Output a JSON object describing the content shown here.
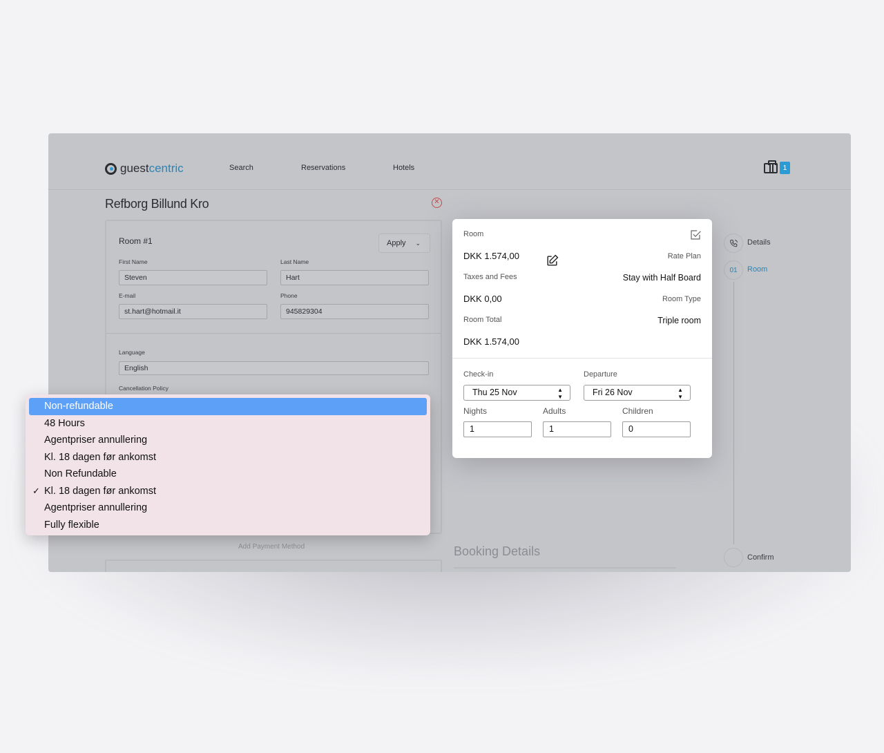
{
  "navbar": {
    "logo_part1": "guest",
    "logo_part2": "centric",
    "links": [
      "Search",
      "Reservations",
      "Hotels"
    ],
    "cart_count": "1"
  },
  "hotel": {
    "title": "Refborg Billund Kro"
  },
  "form": {
    "room_label": "Room #1",
    "apply_label": "Apply",
    "first_name_label": "First Name",
    "first_name_value": "Steven",
    "last_name_label": "Last Name",
    "last_name_value": "Hart",
    "email_label": "E-mail",
    "email_value": "st.hart@hotmail.it",
    "phone_label": "Phone",
    "phone_value": "945829304",
    "language_label": "Language",
    "language_value": "English",
    "cancellation_label": "Cancellation Policy",
    "payment_hint": "Add Payment Method"
  },
  "booking_details_title": "Booking Details",
  "steps": {
    "details_label": "Details",
    "room_number": "01",
    "room_label": "Room",
    "confirm_label": "Confirm"
  },
  "room_card": {
    "room_label": "Room",
    "room_price": "DKK 1.574,00",
    "rate_plan_label": "Rate Plan",
    "rate_plan_value": "Stay with Half Board",
    "taxes_label": "Taxes and Fees",
    "taxes_value": "DKK 0,00",
    "room_type_label": "Room Type",
    "room_type_value": "Triple room",
    "room_total_label": "Room Total",
    "room_total_value": "DKK 1.574,00",
    "checkin_label": "Check-in",
    "checkin_value": "Thu 25 Nov",
    "departure_label": "Departure",
    "departure_value": "Fri 26 Nov",
    "nights_label": "Nights",
    "nights_value": "1",
    "adults_label": "Adults",
    "adults_value": "1",
    "children_label": "Children",
    "children_value": "0"
  },
  "cancellation_dropdown": {
    "options": [
      "Non-refundable",
      "48 Hours",
      "Agentpriser annullering",
      "Kl. 18 dagen før ankomst",
      "Non Refundable",
      "Kl. 18 dagen før ankomst",
      "Agentpriser annullering",
      "Fully flexible"
    ],
    "highlighted_index": 0,
    "checked_index": 5,
    "check_mark": "✓"
  },
  "colors": {
    "accent": "#2b84b5",
    "highlight": "#5ca1f7",
    "dropdown_bg": "#f1e3e8",
    "close_red": "#c24a4a"
  }
}
